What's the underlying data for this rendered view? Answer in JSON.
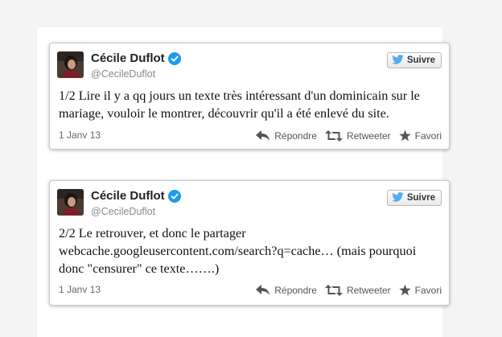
{
  "colors": {
    "verified": "#1d9bf0",
    "follow_bird": "#55acee",
    "background": "#f4f4f4"
  },
  "tweets": [
    {
      "author_name": "Cécile Duflot",
      "author_handle": "@CecileDuflot",
      "follow_label": "Suivre",
      "text": "1/2 Lire il y a qq jours un texte très intéressant d'un dominicain sur le mariage, vouloir le montrer, découvrir qu'il a été enlevé du site.",
      "date": "1 Janv 13",
      "actions": {
        "reply": "Répondre",
        "retweet": "Retweeter",
        "favorite": "Favori"
      }
    },
    {
      "author_name": "Cécile Duflot",
      "author_handle": "@CecileDuflot",
      "follow_label": "Suivre",
      "text_prefix": "2/2 Le retrouver, et donc le partager",
      "link": "webcache.googleusercontent.com/search?q=cache…",
      "text_suffix": " (mais pourquoi donc \"censurer\" ce texte…….)",
      "date": "1 Janv 13",
      "actions": {
        "reply": "Répondre",
        "retweet": "Retweeter",
        "favorite": "Favori"
      }
    }
  ],
  "icons": [
    "verified-icon",
    "twitter-bird-icon",
    "reply-icon",
    "retweet-icon",
    "favorite-star-icon"
  ]
}
